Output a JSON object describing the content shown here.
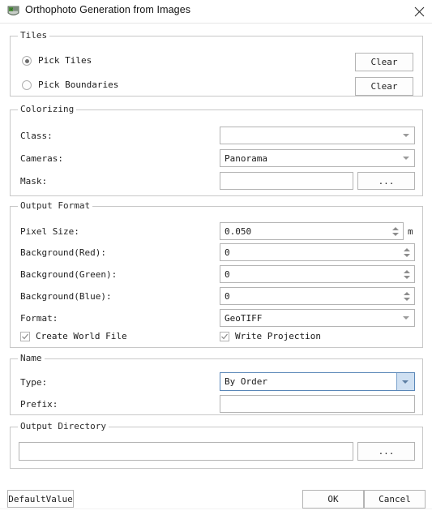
{
  "window": {
    "title": "Orthophoto Generation from Images",
    "icon": "app-orthophoto-icon",
    "close_label": "✕"
  },
  "tiles": {
    "legend": "Tiles",
    "options": [
      {
        "label": "Pick Tiles",
        "selected": true,
        "clear_label": "Clear"
      },
      {
        "label": "Pick Boundaries",
        "selected": false,
        "clear_label": "Clear"
      }
    ]
  },
  "colorizing": {
    "legend": "Colorizing",
    "class_label": "Class:",
    "class_value": "",
    "cameras_label": "Cameras:",
    "cameras_value": "Panorama",
    "mask_label": "Mask:",
    "mask_value": "",
    "mask_browse_label": "..."
  },
  "output_format": {
    "legend": "Output Format",
    "pixel_size_label": "Pixel Size:",
    "pixel_size_value": "0.050",
    "pixel_size_unit": "m",
    "background_red_label": "Background(Red):",
    "background_red_value": "0",
    "background_green_label": "Background(Green):",
    "background_green_value": "0",
    "background_blue_label": "Background(Blue):",
    "background_blue_value": "0",
    "format_label": "Format:",
    "format_value": "GeoTIFF",
    "create_world_file_label": "Create World File",
    "create_world_file_checked": true,
    "write_projection_label": "Write Projection",
    "write_projection_checked": true
  },
  "name": {
    "legend": "Name",
    "type_label": "Type:",
    "type_value": "By Order",
    "prefix_label": "Prefix:",
    "prefix_value": ""
  },
  "output_directory": {
    "legend": "Output Directory",
    "path_value": "",
    "browse_label": "..."
  },
  "footer": {
    "default_value_label": "DefaultValue",
    "ok_label": "OK",
    "cancel_label": "Cancel"
  },
  "colors": {
    "focus_border": "#5a87b8",
    "focus_fill": "#cfe0f2",
    "border": "#c8c8c8",
    "control_border": "#b4b4b4"
  }
}
